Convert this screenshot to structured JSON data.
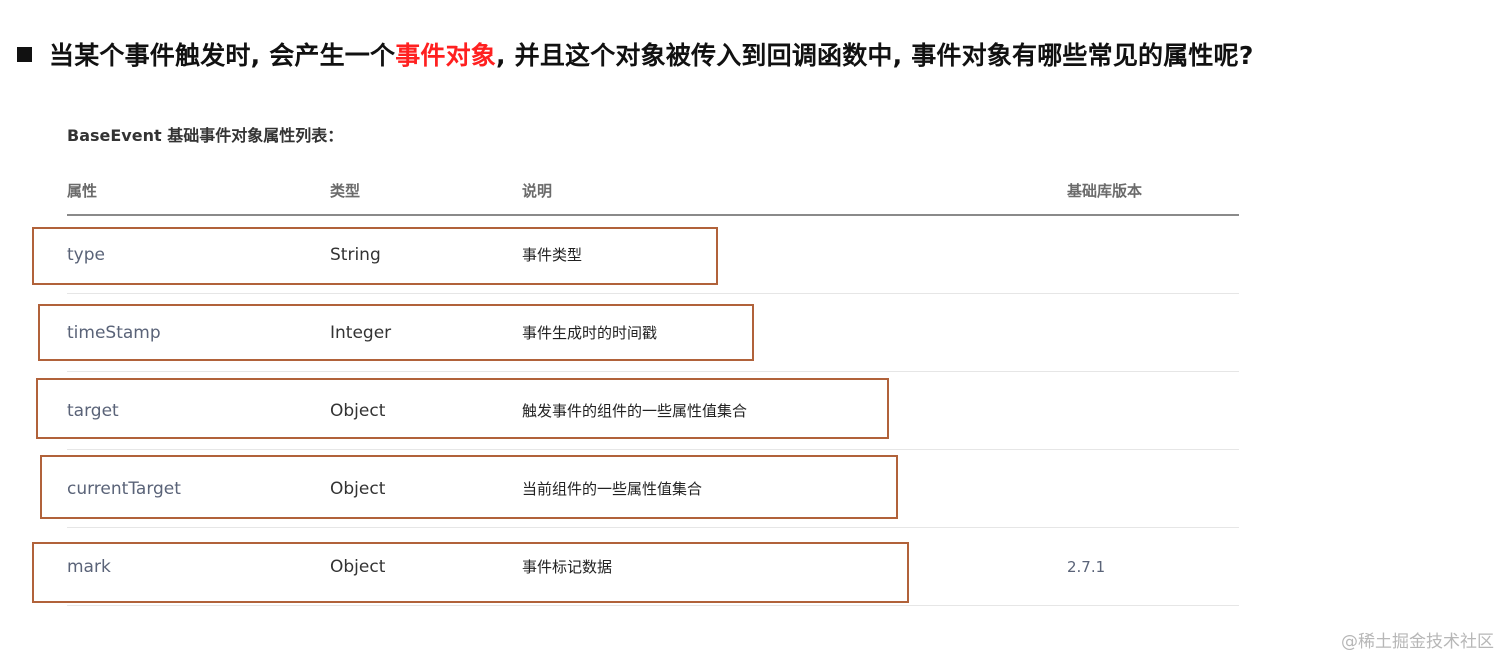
{
  "heading": {
    "part1": "当某个事件触发时, 会产生一个",
    "highlight": "事件对象",
    "part2": ", 并且这个对象被传入到回调函数中, 事件对象有哪些常见的属性呢?"
  },
  "table": {
    "caption": "BaseEvent 基础事件对象属性列表：",
    "headers": {
      "property": "属性",
      "type": "类型",
      "description": "说明",
      "version": "基础库版本"
    },
    "rows": [
      {
        "property": "type",
        "type": "String",
        "description": "事件类型",
        "version": ""
      },
      {
        "property": "timeStamp",
        "type": "Integer",
        "description": "事件生成时的时间戳",
        "version": ""
      },
      {
        "property": "target",
        "type": "Object",
        "description": "触发事件的组件的一些属性值集合",
        "version": ""
      },
      {
        "property": "currentTarget",
        "type": "Object",
        "description": "当前组件的一些属性值集合",
        "version": ""
      },
      {
        "property": "mark",
        "type": "Object",
        "description": "事件标记数据",
        "version": "2.7.1"
      }
    ]
  },
  "watermark": "@稀土掘金技术社区",
  "colors": {
    "highlight_text": "#ff2020",
    "box_border": "#b1623a"
  }
}
